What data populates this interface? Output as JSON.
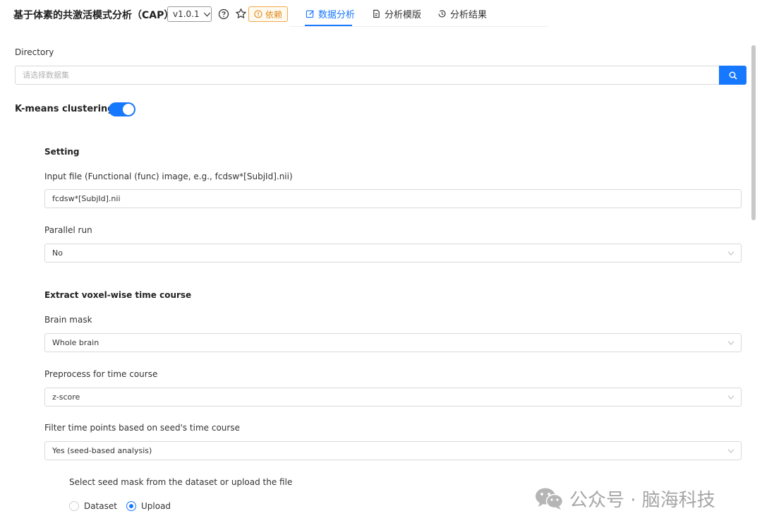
{
  "header": {
    "title": "基于体素的共激活模式分析（CAP）",
    "version": "v1.0.1",
    "dependency_label": "依赖",
    "tabs": [
      {
        "label": "数据分析",
        "active": true
      },
      {
        "label": "分析模版",
        "active": false
      },
      {
        "label": "分析结果",
        "active": false
      }
    ]
  },
  "directory": {
    "label": "Directory",
    "placeholder": "请选择数据集"
  },
  "kmeans": {
    "label": "K-means clustering",
    "enabled": true
  },
  "setting": {
    "title": "Setting",
    "input_file_label": "Input file (Functional (func) image, e.g., fcdsw*[SubjId].nii)",
    "input_file_value": "fcdsw*[SubjId].nii",
    "parallel_label": "Parallel run",
    "parallel_value": "No"
  },
  "extract": {
    "title": "Extract voxel-wise time course",
    "brain_mask_label": "Brain mask",
    "brain_mask_value": "Whole brain",
    "preprocess_label": "Preprocess for time course",
    "preprocess_value": "z-score",
    "filter_label": "Filter time points based on seed's time course",
    "filter_value": "Yes (seed-based analysis)",
    "seed_label": "Select seed mask from the dataset or upload the file",
    "seed_options": [
      {
        "label": "Dataset",
        "checked": false
      },
      {
        "label": "Upload",
        "checked": true
      }
    ]
  },
  "watermark": {
    "text": "公众号 · 脑海科技"
  },
  "colors": {
    "accent": "#1677ff",
    "warning": "#e08a1e"
  }
}
